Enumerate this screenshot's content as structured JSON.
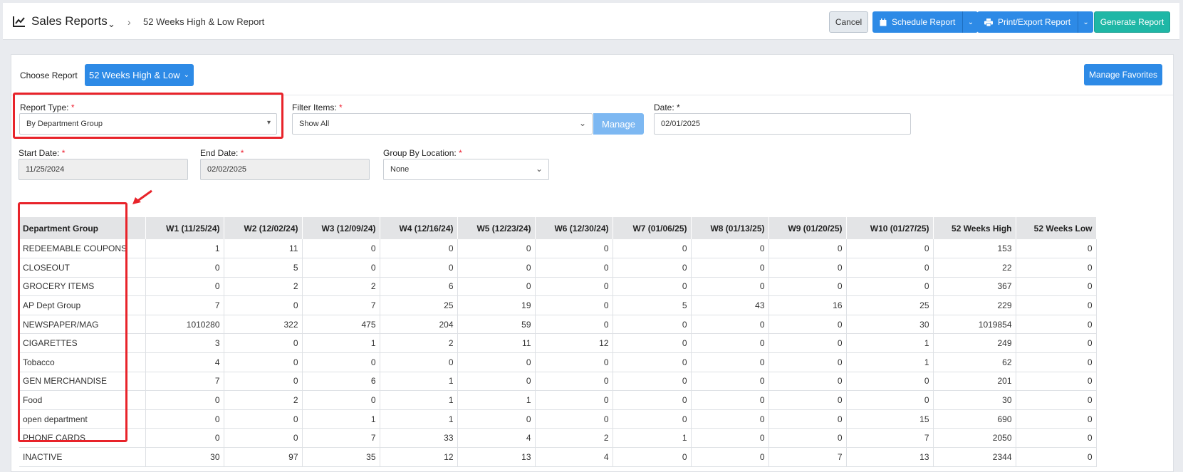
{
  "header": {
    "title": "Sales Reports",
    "breadcrumb": "52 Weeks High & Low Report",
    "cancel_label": "Cancel",
    "schedule_label": "Schedule Report",
    "print_label": "Print/Export Report",
    "generate_label": "Generate Report"
  },
  "choose": {
    "label": "Choose Report",
    "selected": "52 Weeks High & Low",
    "favorites_label": "Manage Favorites"
  },
  "filters": {
    "report_type_label": "Report Type:",
    "report_type_value": "By Department Group",
    "filter_items_label": "Filter Items:",
    "filter_items_value": "Show All",
    "manage_label": "Manage",
    "date_label": "Date:",
    "date_value": "02/01/2025",
    "start_label": "Start Date:",
    "start_value": "11/25/2024",
    "end_label": "End Date:",
    "end_value": "02/02/2025",
    "group_label": "Group By Location:",
    "group_value": "None",
    "required_mark": "*"
  },
  "table": {
    "columns": [
      "Department Group",
      "W1 (11/25/24)",
      "W2 (12/02/24)",
      "W3 (12/09/24)",
      "W4 (12/16/24)",
      "W5 (12/23/24)",
      "W6 (12/30/24)",
      "W7 (01/06/25)",
      "W8 (01/13/25)",
      "W9 (01/20/25)",
      "W10 (01/27/25)",
      "52 Weeks High",
      "52 Weeks Low"
    ],
    "rows": [
      [
        "REDEEMABLE COUPONS",
        "1",
        "11",
        "0",
        "0",
        "0",
        "0",
        "0",
        "0",
        "0",
        "0",
        "153",
        "0"
      ],
      [
        "CLOSEOUT",
        "0",
        "5",
        "0",
        "0",
        "0",
        "0",
        "0",
        "0",
        "0",
        "0",
        "22",
        "0"
      ],
      [
        "GROCERY ITEMS",
        "0",
        "2",
        "2",
        "6",
        "0",
        "0",
        "0",
        "0",
        "0",
        "0",
        "367",
        "0"
      ],
      [
        "AP Dept Group",
        "7",
        "0",
        "7",
        "25",
        "19",
        "0",
        "5",
        "43",
        "16",
        "25",
        "229",
        "0"
      ],
      [
        "NEWSPAPER/MAG",
        "1010280",
        "322",
        "475",
        "204",
        "59",
        "0",
        "0",
        "0",
        "0",
        "30",
        "1019854",
        "0"
      ],
      [
        "CIGARETTES",
        "3",
        "0",
        "1",
        "2",
        "11",
        "12",
        "0",
        "0",
        "0",
        "1",
        "249",
        "0"
      ],
      [
        "Tobacco",
        "4",
        "0",
        "0",
        "0",
        "0",
        "0",
        "0",
        "0",
        "0",
        "1",
        "62",
        "0"
      ],
      [
        "GEN MERCHANDISE",
        "7",
        "0",
        "6",
        "1",
        "0",
        "0",
        "0",
        "0",
        "0",
        "0",
        "201",
        "0"
      ],
      [
        "Food",
        "0",
        "2",
        "0",
        "1",
        "1",
        "0",
        "0",
        "0",
        "0",
        "0",
        "30",
        "0"
      ],
      [
        "open department",
        "0",
        "0",
        "1",
        "1",
        "0",
        "0",
        "0",
        "0",
        "0",
        "15",
        "690",
        "0"
      ],
      [
        "PHONE CARDS",
        "0",
        "0",
        "7",
        "33",
        "4",
        "2",
        "1",
        "0",
        "0",
        "7",
        "2050",
        "0"
      ],
      [
        "INACTIVE",
        "30",
        "97",
        "35",
        "12",
        "13",
        "4",
        "0",
        "0",
        "7",
        "13",
        "2344",
        "0"
      ]
    ]
  },
  "colors": {
    "primary": "#2d8ae6",
    "success": "#1fb7a6",
    "highlight": "#e8232a"
  }
}
